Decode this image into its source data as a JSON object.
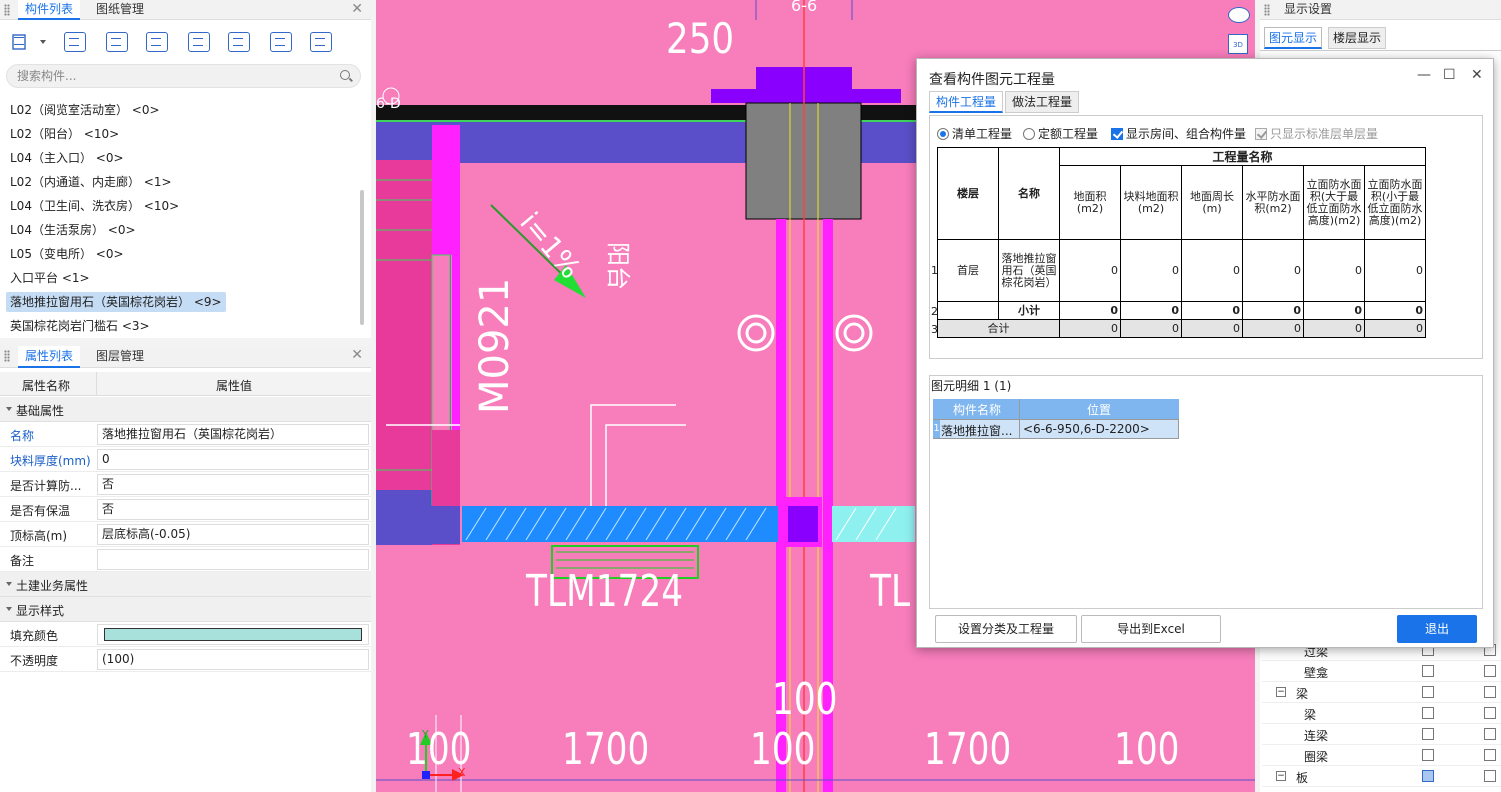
{
  "component_panel": {
    "tabs": [
      "构件列表",
      "图纸管理"
    ],
    "search_placeholder": "搜索构件...",
    "items": [
      "L02（阅览室活动室） <0>",
      "L02（阳台） <10>",
      "L04（主入口） <0>",
      "L02（内通道、内走廊） <1>",
      "L04（卫生间、洗衣房） <10>",
      "L04（生活泵房） <0>",
      "L05（变电所） <0>",
      "入口平台 <1>",
      "落地推拉窗用石（英国棕花岗岩） <9>",
      "英国棕花岗岩门槛石 <3>"
    ],
    "selected_index": 8
  },
  "property_panel": {
    "tabs": [
      "属性列表",
      "图层管理"
    ],
    "header_name": "属性名称",
    "header_value": "属性值",
    "group_basic": "基础属性",
    "rows": [
      {
        "k": "名称",
        "v": "落地推拉窗用石（英国棕花岗岩）",
        "blue": true
      },
      {
        "k": "块料厚度(mm)",
        "v": "0",
        "blue": true
      },
      {
        "k": "是否计算防...",
        "v": "否",
        "blue": false
      },
      {
        "k": "是否有保温",
        "v": "否",
        "blue": false
      },
      {
        "k": "顶标高(m)",
        "v": "层底标高(-0.05)",
        "blue": false
      },
      {
        "k": "备注",
        "v": "",
        "blue": false
      }
    ],
    "group_civil": "土建业务属性",
    "group_display": "显示样式",
    "fill_color_label": "填充颜色",
    "fill_color": "#a8e0dc",
    "opacity_label": "不透明度",
    "opacity_value": "(100)"
  },
  "cad": {
    "label_250": "250",
    "label_66": "6-6",
    "label_6d": "6-D",
    "label_slope": "i=1%",
    "label_balcony": "阳台",
    "label_m0921": "M0921",
    "label_tlm": "TLM1724",
    "label_tl": "TL",
    "label_100_mid": "100",
    "dims": [
      "100",
      "1700",
      "100",
      "1700",
      "100"
    ],
    "axis_x": "X",
    "axis_y": "Y"
  },
  "dialog": {
    "title": "查看构件图元工程量",
    "tabs": [
      "构件工程量",
      "做法工程量"
    ],
    "opt_list": "清单工程量",
    "opt_quota": "定额工程量",
    "opt_show_rooms": "显示房间、组合构件量",
    "opt_std_floor": "只显示标准层单层量",
    "table": {
      "h_floor": "楼层",
      "h_name": "名称",
      "h_group": "工程量名称",
      "cols": [
        "地面积(m2)",
        "块料地面积(m2)",
        "地面周长(m)",
        "水平防水面积(m2)",
        "立面防水面积(大于最低立面防水高度)(m2)",
        "立面防水面积(小于最低立面防水高度)(m2)"
      ],
      "row1_idx": "1",
      "row1_floor": "首层",
      "row1_name": "落地推拉窗用石（英国棕花岗岩）",
      "row1_vals": [
        "0",
        "0",
        "0",
        "0",
        "0",
        "0"
      ],
      "row2_idx": "2",
      "row2_name": "小计",
      "row2_vals": [
        "0",
        "0",
        "0",
        "0",
        "0",
        "0"
      ],
      "row3_idx": "3",
      "row3_name": "合计",
      "row3_vals": [
        "0",
        "0",
        "0",
        "0",
        "0",
        "0"
      ]
    },
    "detail_label": "图元明细",
    "detail_count": "1 (1)",
    "detail_h_name": "构件名称",
    "detail_h_pos": "位置",
    "detail_idx": "1",
    "detail_name": "落地推拉窗...",
    "detail_pos": "<6-6-950,6-D-2200>",
    "btn_classify": "设置分类及工程量",
    "btn_export": "导出到Excel",
    "btn_exit": "退出"
  },
  "right_panel": {
    "title": "显示设置",
    "tabs": [
      "图元显示",
      "楼层显示"
    ],
    "rows": [
      {
        "label": "过梁",
        "indent": 2,
        "minus": false
      },
      {
        "label": "壁龛",
        "indent": 2,
        "minus": false
      },
      {
        "label": "梁",
        "indent": 1,
        "minus": true
      },
      {
        "label": "梁",
        "indent": 2,
        "minus": false
      },
      {
        "label": "连梁",
        "indent": 2,
        "minus": false
      },
      {
        "label": "圈梁",
        "indent": 2,
        "minus": false
      },
      {
        "label": "板",
        "indent": 1,
        "minus": true
      }
    ]
  }
}
